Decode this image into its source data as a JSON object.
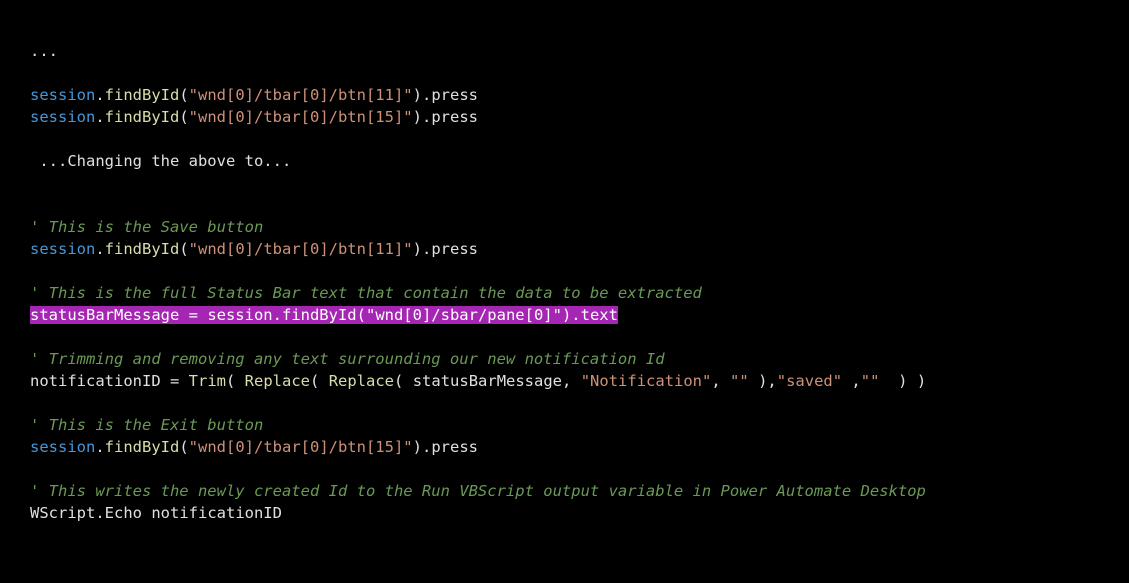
{
  "colors": {
    "background": "#000000",
    "object": "#4697db",
    "method": "#dcdcaa",
    "string": "#ce9178",
    "comment": "#6a9955",
    "highlight": "#a626b4",
    "text": "#e0e0e0"
  },
  "tok": {
    "ellipsis": "...",
    "session": "session",
    "dot": ".",
    "findById": "findById",
    "lparen": "(",
    "rparen": ")",
    "press": "press",
    "text": "text",
    "eq": " = ",
    "comma": ",",
    "space": " ",
    "trim": "Trim",
    "replace": "Replace",
    "wscriptEcho": "WScript.Echo ",
    "statusBarMessage": "statusBarMessage",
    "notificationID": "notificationID"
  },
  "str": {
    "btn11": "\"wnd[0]/tbar[0]/btn[11]\"",
    "btn15": "\"wnd[0]/tbar[0]/btn[15]\"",
    "sbarPane": "\"wnd[0]/sbar/pane[0]\"",
    "notification": "\"Notification\"",
    "saved": "\"saved\"",
    "empty": "\"\""
  },
  "comments": {
    "changing": " ...Changing the above to...",
    "saveBtn": "' This is the Save button",
    "statusBar": "' This is the full Status Bar text that contain the data to be extracted",
    "trimming": "' Trimming and removing any text surrounding our new notification Id",
    "exitBtn": "' This is the Exit button",
    "writes": "' This writes the newly created Id to the Run VBScript output variable in Power Automate Desktop"
  }
}
